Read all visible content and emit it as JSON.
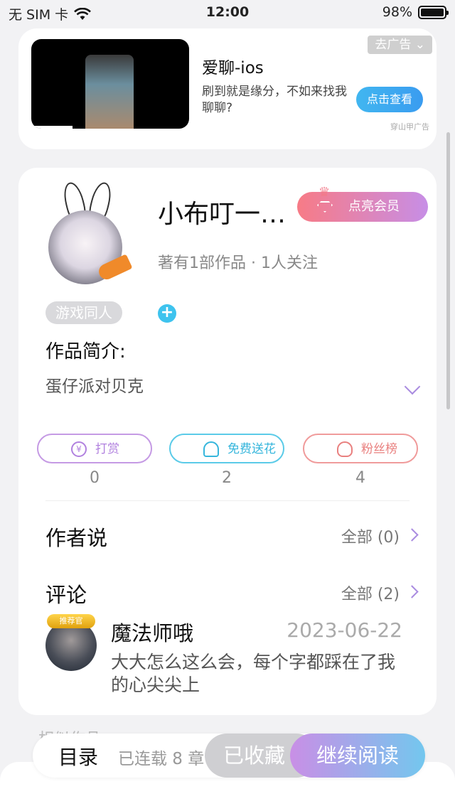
{
  "status_bar": {
    "carrier": "无 SIM 卡",
    "time": "12:00",
    "battery": "98%"
  },
  "ad": {
    "close_label": "去广告",
    "title": "爱聊-ios",
    "description": "刷到就是缘分，不如来找我聊聊?",
    "cta_label": "点击查看",
    "source": "穿山甲广告"
  },
  "author": {
    "name": "小布叮一…",
    "vip_label": "点亮会员",
    "stats": "著有1部作品 · 1人关注",
    "tag": "游戏同人",
    "add_tag": "+"
  },
  "intro": {
    "heading": "作品简介:",
    "text": "蛋仔派对贝克"
  },
  "actions": [
    {
      "label": "打赏",
      "count": "0"
    },
    {
      "label": "免费送花",
      "count": "2"
    },
    {
      "label": "粉丝榜",
      "count": "4"
    }
  ],
  "author_says": {
    "heading": "作者说",
    "all_label": "全部 (0)"
  },
  "comments": {
    "heading": "评论",
    "all_label": "全部 (2)",
    "items": [
      {
        "badge": "推荐官",
        "name": "魔法师哦",
        "date": "2023-06-22",
        "text": "大大怎么这么会，每个字都踩在了我的心尖尖上"
      }
    ]
  },
  "behind_text": "相似作品",
  "bottom_bar": {
    "toc_label": "目录",
    "serial_label": "已连载 8 章",
    "favorite_label": "已收藏",
    "continue_label": "继续阅读"
  }
}
